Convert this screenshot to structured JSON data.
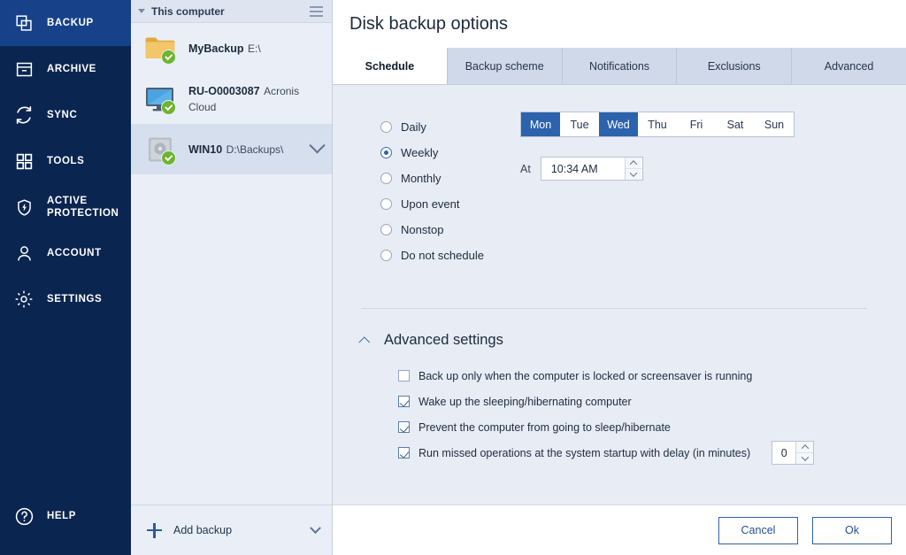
{
  "nav": {
    "items": [
      {
        "id": "backup",
        "label": "BACKUP",
        "icon": "copy-icon",
        "active": true
      },
      {
        "id": "archive",
        "label": "ARCHIVE",
        "icon": "archive-box-icon",
        "active": false
      },
      {
        "id": "sync",
        "label": "SYNC",
        "icon": "sync-arrows-icon",
        "active": false
      },
      {
        "id": "tools",
        "label": "TOOLS",
        "icon": "grid-squares-icon",
        "active": false
      },
      {
        "id": "active-protection",
        "label": "ACTIVE\nPROTECTION",
        "icon": "shield-bolt-icon",
        "active": false
      },
      {
        "id": "account",
        "label": "ACCOUNT",
        "icon": "person-icon",
        "active": false
      },
      {
        "id": "settings",
        "label": "SETTINGS",
        "icon": "gear-icon",
        "active": false
      }
    ],
    "help": {
      "label": "HELP",
      "icon": "question-circle-icon"
    },
    "colors": {
      "background": "#0b2551",
      "active_background": "#17428a",
      "text": "#ffffff"
    }
  },
  "backup_list": {
    "header": {
      "title": "This computer",
      "collapse_icon": "triangle-down-icon",
      "menu_icon": "hamburger-icon"
    },
    "items": [
      {
        "name": "MyBackup",
        "destination": "E:\\",
        "icon": "folder-icon",
        "status": "ok",
        "selected": false,
        "has_chevron": false
      },
      {
        "name": "RU-O0003087",
        "destination": "Acronis Cloud",
        "icon": "monitor-icon",
        "status": "ok",
        "selected": false,
        "has_chevron": false
      },
      {
        "name": "WIN10",
        "destination": "D:\\Backups\\",
        "icon": "harddisk-icon",
        "status": "ok",
        "selected": true,
        "has_chevron": true
      }
    ],
    "add_backup": {
      "label": "Add backup",
      "plus_icon": "plus-icon",
      "chevron_icon": "chevron-down-icon"
    }
  },
  "main": {
    "title": "Disk backup options",
    "tabs": [
      {
        "id": "schedule",
        "label": "Schedule",
        "active": true
      },
      {
        "id": "backup-scheme",
        "label": "Backup scheme",
        "active": false
      },
      {
        "id": "notifications",
        "label": "Notifications",
        "active": false
      },
      {
        "id": "exclusions",
        "label": "Exclusions",
        "active": false
      },
      {
        "id": "advanced",
        "label": "Advanced",
        "active": false
      }
    ],
    "schedule": {
      "frequency_options": [
        {
          "id": "daily",
          "label": "Daily",
          "selected": false
        },
        {
          "id": "weekly",
          "label": "Weekly",
          "selected": true
        },
        {
          "id": "monthly",
          "label": "Monthly",
          "selected": false
        },
        {
          "id": "upon-event",
          "label": "Upon event",
          "selected": false
        },
        {
          "id": "nonstop",
          "label": "Nonstop",
          "selected": false
        },
        {
          "id": "do-not-schedule",
          "label": "Do not schedule",
          "selected": false
        }
      ],
      "weekdays": [
        {
          "id": "mon",
          "label": "Mon",
          "selected": true
        },
        {
          "id": "tue",
          "label": "Tue",
          "selected": false
        },
        {
          "id": "wed",
          "label": "Wed",
          "selected": true
        },
        {
          "id": "thu",
          "label": "Thu",
          "selected": false
        },
        {
          "id": "fri",
          "label": "Fri",
          "selected": false
        },
        {
          "id": "sat",
          "label": "Sat",
          "selected": false
        },
        {
          "id": "sun",
          "label": "Sun",
          "selected": false
        }
      ],
      "at_label": "At",
      "time_value": "10:34 AM"
    },
    "advanced_settings": {
      "title": "Advanced settings",
      "expanded": true,
      "caret_icon": "chevron-up-icon",
      "checkboxes": [
        {
          "id": "locked-or-screensaver",
          "label": "Back up only when the computer is locked or screensaver is running",
          "checked": false
        },
        {
          "id": "wake-up",
          "label": "Wake up the sleeping/hibernating computer",
          "checked": true
        },
        {
          "id": "prevent-sleep",
          "label": "Prevent the computer from going to sleep/hibernate",
          "checked": true
        },
        {
          "id": "run-missed",
          "label": "Run missed operations at the system startup with delay (in minutes)",
          "checked": true
        }
      ],
      "delay_value": "0"
    },
    "footer": {
      "cancel_label": "Cancel",
      "ok_label": "Ok"
    }
  },
  "theme": {
    "accent_blue": "#2d62ac",
    "nav_blue": "#0b2551",
    "panel_bg": "#eaeff7",
    "main_bg": "#e7ecf5",
    "status_green": "#6cb52d"
  }
}
